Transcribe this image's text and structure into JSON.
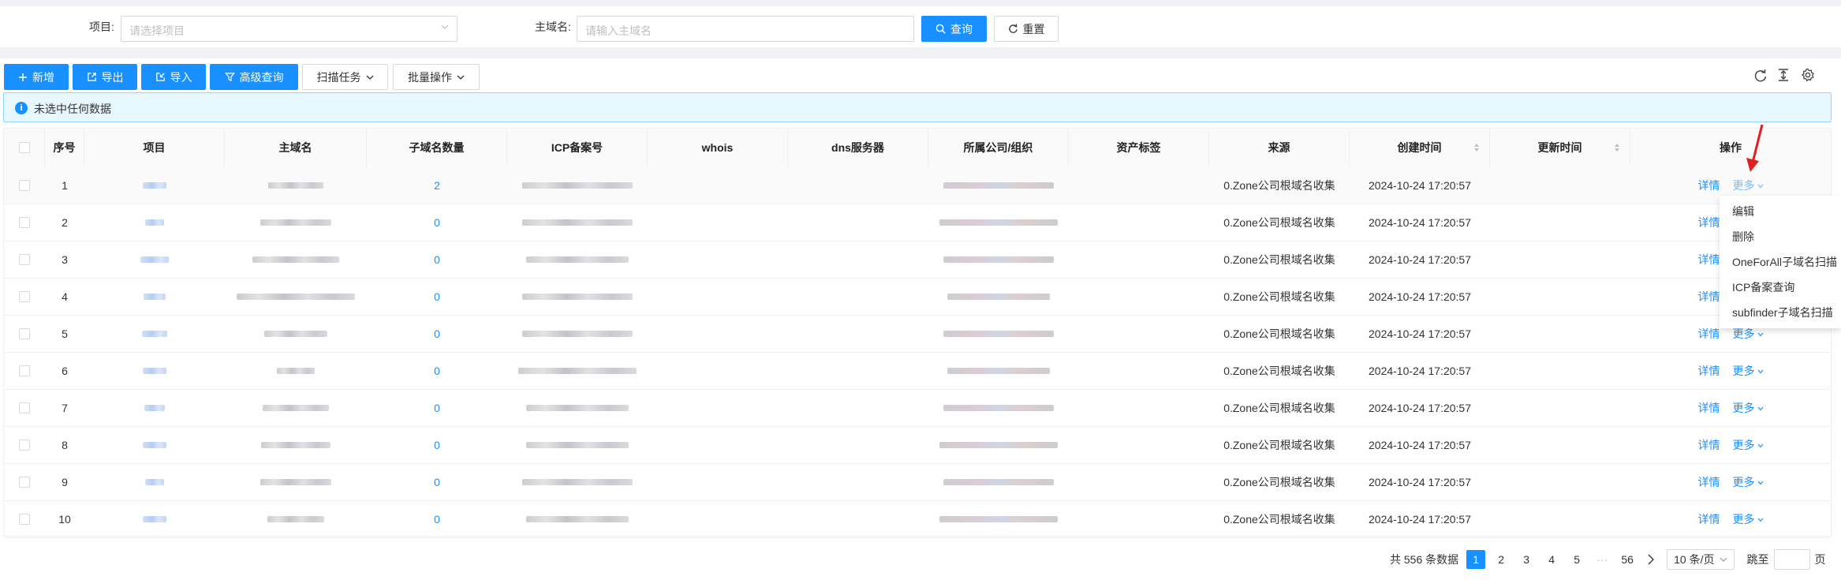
{
  "filters": {
    "project_label": "项目:",
    "project_placeholder": "请选择项目",
    "domain_label": "主域名:",
    "domain_placeholder": "请输入主域名",
    "query_label": "查询",
    "reset_label": "重置"
  },
  "toolbar": {
    "add": "新增",
    "export": "导出",
    "import": "导入",
    "advanced": "高级查询",
    "scan_task": "扫描任务",
    "batch": "批量操作"
  },
  "alert": {
    "text": "未选中任何数据"
  },
  "columns": [
    "序号",
    "项目",
    "主域名",
    "子域名数量",
    "ICP备案号",
    "whois",
    "dns服务器",
    "所属公司/组织",
    "资产标签",
    "来源",
    "创建时间",
    "更新时间",
    "操作"
  ],
  "rows": [
    {
      "index": "1",
      "subdomain_count": "2",
      "source": "0.Zone公司根域名收集",
      "created": "2024-10-24 17:20:57"
    },
    {
      "index": "2",
      "subdomain_count": "0",
      "source": "0.Zone公司根域名收集",
      "created": "2024-10-24 17:20:57"
    },
    {
      "index": "3",
      "subdomain_count": "0",
      "source": "0.Zone公司根域名收集",
      "created": "2024-10-24 17:20:57"
    },
    {
      "index": "4",
      "subdomain_count": "0",
      "source": "0.Zone公司根域名收集",
      "created": "2024-10-24 17:20:57"
    },
    {
      "index": "5",
      "subdomain_count": "0",
      "source": "0.Zone公司根域名收集",
      "created": "2024-10-24 17:20:57"
    },
    {
      "index": "6",
      "subdomain_count": "0",
      "source": "0.Zone公司根域名收集",
      "created": "2024-10-24 17:20:57"
    },
    {
      "index": "7",
      "subdomain_count": "0",
      "source": "0.Zone公司根域名收集",
      "created": "2024-10-24 17:20:57"
    },
    {
      "index": "8",
      "subdomain_count": "0",
      "source": "0.Zone公司根域名收集",
      "created": "2024-10-24 17:20:57"
    },
    {
      "index": "9",
      "subdomain_count": "0",
      "source": "0.Zone公司根域名收集",
      "created": "2024-10-24 17:20:57"
    },
    {
      "index": "10",
      "subdomain_count": "0",
      "source": "0.Zone公司根域名收集",
      "created": "2024-10-24 17:20:57"
    }
  ],
  "row_actions": {
    "detail": "详情",
    "more": "更多"
  },
  "dropdown": [
    "编辑",
    "删除",
    "OneForAll子域名扫描",
    "ICP备案查询",
    "subfinder子域名扫描"
  ],
  "pagination": {
    "total": "共 556 条数据",
    "pages": [
      "1",
      "2",
      "3",
      "4",
      "5"
    ],
    "ellipsis": "···",
    "last": "56",
    "page_size": "10 条/页",
    "jump_label": "跳至",
    "page_suffix": "页"
  },
  "colors": {
    "primary": "#1890ff",
    "alert_bg": "#e6f7ff",
    "annotation_arrow": "#e02020"
  },
  "icons": [
    "plus-icon",
    "export-icon",
    "import-icon",
    "filter-icon",
    "chevron-down-icon",
    "search-icon",
    "reset-icon",
    "refresh-icon",
    "column-height-icon",
    "settings-icon",
    "info-icon",
    "arrow-annotation"
  ]
}
